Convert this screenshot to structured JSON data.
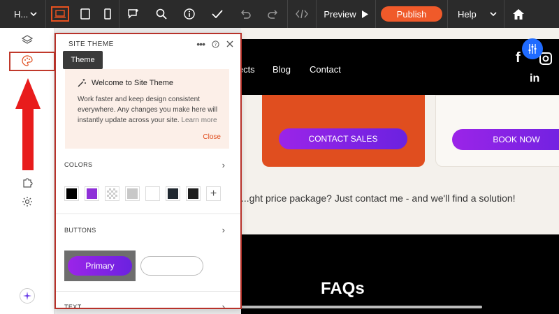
{
  "topbar": {
    "page_name": "H...",
    "preview_label": "Preview",
    "publish_label": "Publish",
    "help_label": "Help"
  },
  "canvas": {
    "nav": [
      "...ects",
      "Blog",
      "Contact"
    ],
    "contact_sales_label": "CONTACT SALES",
    "book_now_label": "BOOK NOW",
    "body_text": "...ght price package? Just contact me - and we'll find a solution!",
    "faq_heading": "FAQs",
    "social_facebook": "f",
    "social_linkedin": "in"
  },
  "panel": {
    "title": "SITE THEME",
    "tooltip": "Theme",
    "welcome_title": "Welcome to Site Theme",
    "welcome_body": "Work faster and keep design consistent everywhere. Any changes you make here will instantly update across your site.",
    "learn_more": "Learn more",
    "close_label": "Close",
    "colors_label": "COLORS",
    "buttons_label": "BUTTONS",
    "text_label": "TEXT",
    "primary_sample_label": "Primary",
    "swatches": [
      "#000000",
      "#8e2fd8",
      "transparent",
      "#c8c8c8",
      "#ffffff",
      "#202830",
      "#1e1e1e"
    ]
  },
  "colors": {
    "accent": "#f05a2a",
    "highlight": "#b8322a",
    "purple": "#7a22e4",
    "topbar": "#2b2b2b"
  }
}
